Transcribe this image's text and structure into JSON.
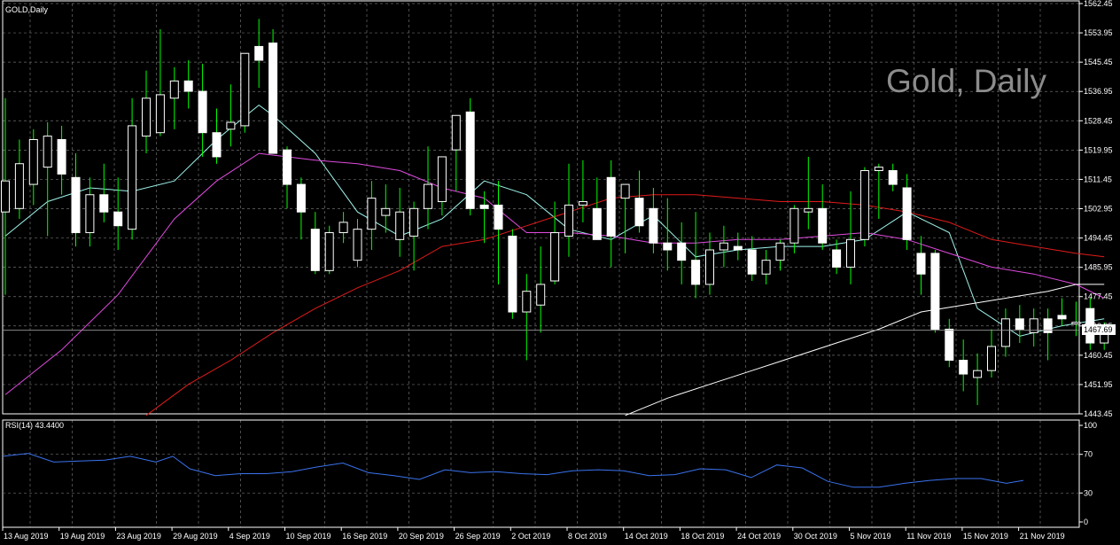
{
  "window": {
    "symbol_label": "GOLD,Daily",
    "watermark": "Gold, Daily"
  },
  "colors": {
    "background": "#000000",
    "grid": "#6c6c6c",
    "axis": "#ffffff",
    "bull_body": "#ffffff",
    "bear_body": "#ffffff",
    "wick": "#00ff00",
    "ma_cyan": "#9ef3ea",
    "ma_magenta": "#e04be0",
    "ma_red": "#e01b1b",
    "ma_white": "#ffffff",
    "rsi_line": "#3a73ee",
    "price_tag_bg": "#ffffff",
    "price_tag_text": "#000000"
  },
  "chart_data": [
    {
      "type": "candlestick",
      "title": "GOLD,Daily",
      "x_tick_labels": [
        "13 Aug 2019",
        "19 Aug 2019",
        "23 Aug 2019",
        "29 Aug 2019",
        "4 Sep 2019",
        "10 Sep 2019",
        "16 Sep 2019",
        "20 Sep 2019",
        "26 Sep 2019",
        "2 Oct 2019",
        "8 Oct 2019",
        "14 Oct 2019",
        "18 Oct 2019",
        "24 Oct 2019",
        "30 Oct 2019",
        "5 Nov 2019",
        "11 Nov 2019",
        "15 Nov 2019",
        "21 Nov 2019"
      ],
      "y_tick_labels": [
        "1562.45",
        "1553.95",
        "1545.45",
        "1536.95",
        "1528.45",
        "1519.95",
        "1511.45",
        "1502.95",
        "1494.45",
        "1485.95",
        "1477.45",
        "1468.95",
        "1460.45",
        "1451.95",
        "1443.45"
      ],
      "ylim": [
        1443.45,
        1562.45
      ],
      "grid": true,
      "last_price": "1467.69",
      "candles": [
        {
          "o": 1502,
          "h": 1535,
          "l": 1478,
          "c": 1511
        },
        {
          "o": 1503,
          "h": 1523,
          "l": 1500,
          "c": 1516
        },
        {
          "o": 1510,
          "h": 1526,
          "l": 1504,
          "c": 1523
        },
        {
          "o": 1515,
          "h": 1528,
          "l": 1495,
          "c": 1524
        },
        {
          "o": 1523,
          "h": 1527,
          "l": 1507,
          "c": 1513
        },
        {
          "o": 1512,
          "h": 1519,
          "l": 1492,
          "c": 1496
        },
        {
          "o": 1496,
          "h": 1512,
          "l": 1492,
          "c": 1507
        },
        {
          "o": 1507,
          "h": 1516,
          "l": 1499,
          "c": 1502
        },
        {
          "o": 1502,
          "h": 1512,
          "l": 1491,
          "c": 1498
        },
        {
          "o": 1497,
          "h": 1535,
          "l": 1494,
          "c": 1527
        },
        {
          "o": 1524,
          "h": 1543,
          "l": 1519,
          "c": 1535
        },
        {
          "o": 1525,
          "h": 1555,
          "l": 1524,
          "c": 1536
        },
        {
          "o": 1535,
          "h": 1544,
          "l": 1526,
          "c": 1540
        },
        {
          "o": 1540,
          "h": 1546,
          "l": 1532,
          "c": 1537
        },
        {
          "o": 1537,
          "h": 1545,
          "l": 1518,
          "c": 1525
        },
        {
          "o": 1525,
          "h": 1532,
          "l": 1516,
          "c": 1518
        },
        {
          "o": 1526,
          "h": 1539,
          "l": 1521,
          "c": 1528
        },
        {
          "o": 1527,
          "h": 1548,
          "l": 1525,
          "c": 1548
        },
        {
          "o": 1550,
          "h": 1558,
          "l": 1538,
          "c": 1546
        },
        {
          "o": 1551,
          "h": 1555,
          "l": 1519,
          "c": 1519
        },
        {
          "o": 1520,
          "h": 1521,
          "l": 1503,
          "c": 1510
        },
        {
          "o": 1510,
          "h": 1512,
          "l": 1494,
          "c": 1502
        },
        {
          "o": 1497,
          "h": 1502,
          "l": 1484,
          "c": 1485
        },
        {
          "o": 1485,
          "h": 1498,
          "l": 1484,
          "c": 1496
        },
        {
          "o": 1496,
          "h": 1502,
          "l": 1493,
          "c": 1499
        },
        {
          "o": 1488,
          "h": 1500,
          "l": 1486,
          "c": 1497
        },
        {
          "o": 1497,
          "h": 1511,
          "l": 1491,
          "c": 1506
        },
        {
          "o": 1501,
          "h": 1510,
          "l": 1496,
          "c": 1503
        },
        {
          "o": 1494,
          "h": 1509,
          "l": 1489,
          "c": 1502
        },
        {
          "o": 1495,
          "h": 1505,
          "l": 1485,
          "c": 1503
        },
        {
          "o": 1503,
          "h": 1521,
          "l": 1497,
          "c": 1510
        },
        {
          "o": 1505,
          "h": 1518,
          "l": 1501,
          "c": 1518
        },
        {
          "o": 1520,
          "h": 1530,
          "l": 1508,
          "c": 1530
        },
        {
          "o": 1531,
          "h": 1535,
          "l": 1501,
          "c": 1503
        },
        {
          "o": 1504,
          "h": 1508,
          "l": 1493,
          "c": 1503
        },
        {
          "o": 1504,
          "h": 1511,
          "l": 1481,
          "c": 1497
        },
        {
          "o": 1495,
          "h": 1497,
          "l": 1471,
          "c": 1473
        },
        {
          "o": 1473,
          "h": 1484,
          "l": 1459,
          "c": 1479
        },
        {
          "o": 1475,
          "h": 1492,
          "l": 1467,
          "c": 1481
        },
        {
          "o": 1482,
          "h": 1505,
          "l": 1481,
          "c": 1496
        },
        {
          "o": 1495,
          "h": 1516,
          "l": 1489,
          "c": 1504
        },
        {
          "o": 1504,
          "h": 1517,
          "l": 1499,
          "c": 1505
        },
        {
          "o": 1503,
          "h": 1512,
          "l": 1495,
          "c": 1494
        },
        {
          "o": 1512,
          "h": 1517,
          "l": 1486,
          "c": 1495
        },
        {
          "o": 1506,
          "h": 1510,
          "l": 1490,
          "c": 1510
        },
        {
          "o": 1506,
          "h": 1514,
          "l": 1496,
          "c": 1498
        },
        {
          "o": 1503,
          "h": 1509,
          "l": 1490,
          "c": 1493
        },
        {
          "o": 1493,
          "h": 1506,
          "l": 1485,
          "c": 1491
        },
        {
          "o": 1493,
          "h": 1499,
          "l": 1481,
          "c": 1488
        },
        {
          "o": 1488,
          "h": 1502,
          "l": 1477,
          "c": 1481
        },
        {
          "o": 1481,
          "h": 1496,
          "l": 1478,
          "c": 1491
        },
        {
          "o": 1491,
          "h": 1498,
          "l": 1486,
          "c": 1493
        },
        {
          "o": 1492,
          "h": 1496,
          "l": 1488,
          "c": 1491
        },
        {
          "o": 1491,
          "h": 1495,
          "l": 1482,
          "c": 1484
        },
        {
          "o": 1484,
          "h": 1491,
          "l": 1481,
          "c": 1488
        },
        {
          "o": 1488,
          "h": 1494,
          "l": 1485,
          "c": 1493
        },
        {
          "o": 1493,
          "h": 1504,
          "l": 1490,
          "c": 1503
        },
        {
          "o": 1502,
          "h": 1518,
          "l": 1497,
          "c": 1503
        },
        {
          "o": 1503,
          "h": 1510,
          "l": 1491,
          "c": 1493
        },
        {
          "o": 1491,
          "h": 1494,
          "l": 1484,
          "c": 1486
        },
        {
          "o": 1486,
          "h": 1508,
          "l": 1481,
          "c": 1494
        },
        {
          "o": 1494,
          "h": 1515,
          "l": 1492,
          "c": 1514
        },
        {
          "o": 1514,
          "h": 1516,
          "l": 1500,
          "c": 1515
        },
        {
          "o": 1514,
          "h": 1516,
          "l": 1508,
          "c": 1510
        },
        {
          "o": 1509,
          "h": 1513,
          "l": 1491,
          "c": 1494
        },
        {
          "o": 1490,
          "h": 1495,
          "l": 1478,
          "c": 1484
        },
        {
          "o": 1490,
          "h": 1491,
          "l": 1467,
          "c": 1468
        },
        {
          "o": 1468,
          "h": 1471,
          "l": 1457,
          "c": 1459
        },
        {
          "o": 1459,
          "h": 1465,
          "l": 1450,
          "c": 1455
        },
        {
          "o": 1454,
          "h": 1461,
          "l": 1446,
          "c": 1456
        },
        {
          "o": 1456,
          "h": 1468,
          "l": 1454,
          "c": 1463
        },
        {
          "o": 1463,
          "h": 1474,
          "l": 1460,
          "c": 1471
        },
        {
          "o": 1471,
          "h": 1475,
          "l": 1464,
          "c": 1468
        },
        {
          "o": 1467,
          "h": 1474,
          "l": 1463,
          "c": 1471
        },
        {
          "o": 1471,
          "h": 1474,
          "l": 1459,
          "c": 1467
        },
        {
          "o": 1472,
          "h": 1477,
          "l": 1469,
          "c": 1471
        },
        {
          "o": 1470,
          "h": 1476,
          "l": 1466,
          "c": 1470
        },
        {
          "o": 1474,
          "h": 1477,
          "l": 1462,
          "c": 1464
        },
        {
          "o": 1464,
          "h": 1470,
          "l": 1462,
          "c": 1467.69
        }
      ],
      "moving_averages": [
        {
          "color": "#9ef3ea",
          "values": [
            [
              0,
              1495
            ],
            [
              3,
              1505
            ],
            [
              6,
              1509
            ],
            [
              9,
              1508
            ],
            [
              12,
              1511
            ],
            [
              15,
              1523
            ],
            [
              18,
              1533
            ],
            [
              19,
              1530
            ],
            [
              22,
              1519
            ],
            [
              25,
              1502
            ],
            [
              28,
              1495
            ],
            [
              31,
              1500
            ],
            [
              34,
              1511
            ],
            [
              37,
              1507
            ],
            [
              40,
              1497
            ],
            [
              43,
              1494
            ],
            [
              46,
              1501
            ],
            [
              49,
              1489
            ],
            [
              52,
              1491
            ],
            [
              55,
              1492
            ],
            [
              58,
              1492
            ],
            [
              61,
              1494
            ],
            [
              64,
              1502
            ],
            [
              67,
              1496
            ],
            [
              69,
              1474
            ],
            [
              72,
              1466
            ],
            [
              75,
              1469
            ],
            [
              78,
              1471
            ]
          ]
        },
        {
          "color": "#e04be0",
          "values": [
            [
              0,
              1449
            ],
            [
              4,
              1462
            ],
            [
              8,
              1478
            ],
            [
              12,
              1500
            ],
            [
              15,
              1511
            ],
            [
              18,
              1519
            ],
            [
              22,
              1517
            ],
            [
              25,
              1516
            ],
            [
              28,
              1514
            ],
            [
              31,
              1509
            ],
            [
              34,
              1506
            ],
            [
              37,
              1496
            ],
            [
              40,
              1496
            ],
            [
              43,
              1495
            ],
            [
              46,
              1493
            ],
            [
              49,
              1493
            ],
            [
              52,
              1494
            ],
            [
              55,
              1494
            ],
            [
              58,
              1495
            ],
            [
              61,
              1496
            ],
            [
              64,
              1494
            ],
            [
              67,
              1490
            ],
            [
              70,
              1486
            ],
            [
              73,
              1484
            ],
            [
              76,
              1481
            ],
            [
              78,
              1477
            ]
          ]
        },
        {
          "color": "#e01b1b",
          "values": [
            [
              10,
              1443
            ],
            [
              13,
              1452
            ],
            [
              16,
              1459
            ],
            [
              19,
              1467
            ],
            [
              22,
              1474
            ],
            [
              25,
              1480
            ],
            [
              28,
              1485
            ],
            [
              31,
              1492
            ],
            [
              34,
              1494
            ],
            [
              37,
              1498
            ],
            [
              40,
              1502
            ],
            [
              43,
              1506
            ],
            [
              46,
              1507
            ],
            [
              49,
              1507
            ],
            [
              52,
              1506
            ],
            [
              55,
              1505
            ],
            [
              58,
              1505
            ],
            [
              61,
              1504
            ],
            [
              64,
              1502
            ],
            [
              67,
              1499
            ],
            [
              70,
              1494
            ],
            [
              73,
              1492
            ],
            [
              76,
              1490
            ],
            [
              78,
              1489
            ]
          ]
        },
        {
          "color": "#ffffff",
          "values": [
            [
              44,
              1443
            ],
            [
              47,
              1448
            ],
            [
              50,
              1452
            ],
            [
              53,
              1456
            ],
            [
              56,
              1460
            ],
            [
              59,
              1464
            ],
            [
              62,
              1468
            ],
            [
              65,
              1473
            ],
            [
              68,
              1475
            ],
            [
              71,
              1477
            ],
            [
              74,
              1479
            ],
            [
              76,
              1481
            ],
            [
              78,
              1481
            ]
          ]
        }
      ]
    },
    {
      "type": "line",
      "title": "RSI(14) 43.4400",
      "ylim": [
        0,
        100
      ],
      "y_tick_labels": [
        "100",
        "70",
        "30",
        "0"
      ],
      "levels": [
        70,
        30
      ],
      "series": [
        {
          "values": [
            [
              0,
              68
            ],
            [
              3,
              71
            ],
            [
              6,
              62
            ],
            [
              9,
              63
            ],
            [
              12,
              64
            ],
            [
              15,
              68
            ],
            [
              18,
              62
            ],
            [
              20,
              68
            ],
            [
              22,
              55
            ],
            [
              25,
              48
            ],
            [
              28,
              50
            ],
            [
              31,
              50
            ],
            [
              34,
              52
            ],
            [
              37,
              57
            ],
            [
              40,
              61
            ],
            [
              43,
              51
            ],
            [
              46,
              48
            ],
            [
              49,
              44
            ],
            [
              52,
              54
            ],
            [
              55,
              51
            ],
            [
              58,
              52
            ],
            [
              61,
              50
            ],
            [
              64,
              49
            ],
            [
              67,
              53
            ],
            [
              70,
              54
            ],
            [
              73,
              53
            ],
            [
              76,
              48
            ],
            [
              79,
              49
            ],
            [
              82,
              55
            ],
            [
              85,
              54
            ],
            [
              88,
              46
            ],
            [
              91,
              59
            ],
            [
              94,
              56
            ],
            [
              97,
              42
            ],
            [
              100,
              36
            ],
            [
              103,
              36
            ],
            [
              106,
              40
            ],
            [
              109,
              43
            ],
            [
              112,
              45
            ],
            [
              115,
              45
            ],
            [
              118,
              40
            ],
            [
              120,
              43
            ]
          ]
        }
      ]
    }
  ]
}
